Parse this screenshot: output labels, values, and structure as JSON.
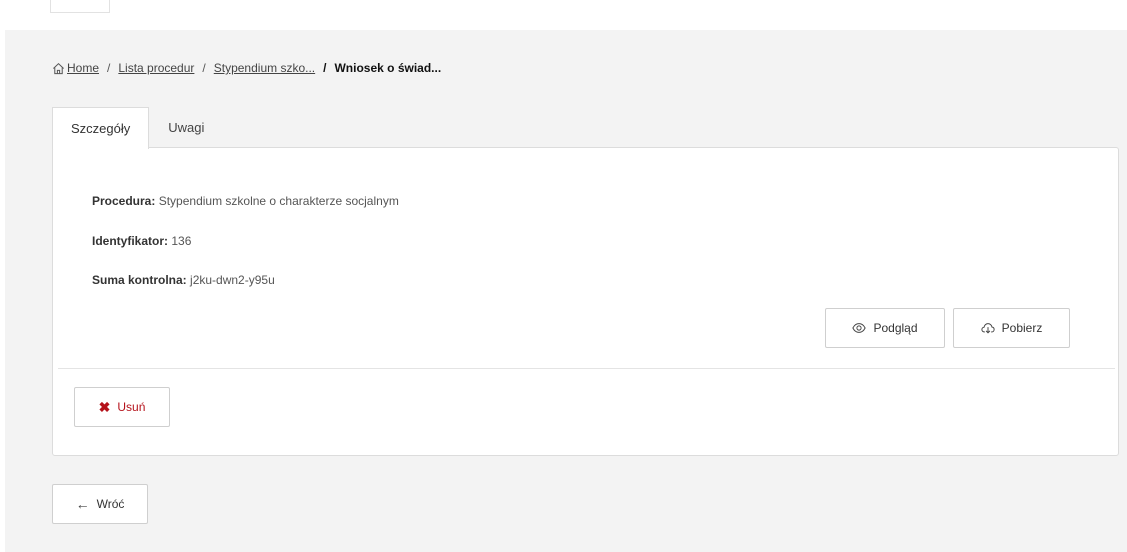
{
  "breadcrumb": {
    "home": "Home",
    "separator": "/",
    "items": [
      "Lista procedur",
      "Stypendium szko..."
    ],
    "current": "Wniosek o świad..."
  },
  "tabs": [
    {
      "label": "Szczegóły",
      "active": true
    },
    {
      "label": "Uwagi",
      "active": false
    }
  ],
  "details": {
    "procedure_label": "Procedura:",
    "procedure_value": "Stypendium szkolne o charakterze socjalnym",
    "id_label": "Identyfikator:",
    "id_value": "136",
    "checksum_label": "Suma kontrolna:",
    "checksum_value": "j2ku-dwn2-y95u"
  },
  "actions": {
    "preview": "Podgląd",
    "download": "Pobierz",
    "delete": "Usuń"
  },
  "back": {
    "arrow": "←",
    "label": "Wróć"
  },
  "colors": {
    "background": "#f3f3f3",
    "danger": "#b5121b",
    "border": "#dcdcdc"
  },
  "icons": {
    "home": "home-icon",
    "preview": "eye-icon",
    "download": "cloud-download-icon",
    "delete": "close-icon",
    "back": "arrow-left-icon"
  }
}
